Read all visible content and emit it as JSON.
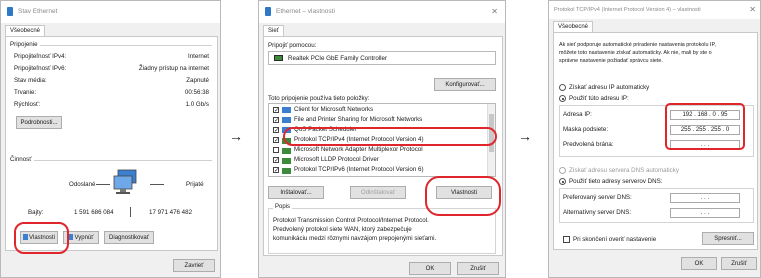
{
  "arrows": [
    "→",
    "→"
  ],
  "win1": {
    "title": "Stav Ethernet",
    "close": "✕",
    "tab": "Všeobecné",
    "connection_group": "Pripojenie",
    "rows": [
      {
        "label": "Pripojiteľnosť IPv4:",
        "value": "Internet"
      },
      {
        "label": "Pripojiteľnosť IPv6:",
        "value": "Žiadny prístup na internet"
      },
      {
        "label": "Stav média:",
        "value": "Zapnuté"
      },
      {
        "label": "Trvanie:",
        "value": "00:56:38"
      },
      {
        "label": "Rýchlosť:",
        "value": "1.0 Gb/s"
      }
    ],
    "details_btn": "Podrobnosti...",
    "activity_group": "Činnosť",
    "sent": "Odoslané",
    "received": "Prijaté",
    "bytes_label": "Bajty:",
    "bytes_sent": "1 591 686 084",
    "bytes_received": "17 971 476 482",
    "properties_btn": "Vlastnosti",
    "disable_btn": "Vypnúť",
    "diagnose_btn": "Diagnostikovať",
    "close_btn": "Zavrieť"
  },
  "win2": {
    "title": "Ethernet – vlastnosti",
    "close": "✕",
    "tab": "Sieť",
    "connect_using": "Pripojiť pomocou:",
    "adapter": "Realtek PCIe GbE Family Controller",
    "configure_btn": "Konfigurovať...",
    "items_label": "Toto pripojenie používa tieto položky:",
    "items": [
      {
        "label": "Client for Microsoft Networks",
        "checked": true
      },
      {
        "label": "File and Printer Sharing for Microsoft Networks",
        "checked": true
      },
      {
        "label": "QoS Packet Scheduler",
        "checked": true
      },
      {
        "label": "Protokol TCP/IPv4 (Internet Protocol Version 4)",
        "checked": true
      },
      {
        "label": "Microsoft Network Adapter Multiplexor Protocol",
        "checked": false
      },
      {
        "label": "Microsoft LLDP Protocol Driver",
        "checked": true
      },
      {
        "label": "Protokol TCP/IPv6 (Internet Protocol Version 6)",
        "checked": true
      }
    ],
    "install_btn": "Inštalovať...",
    "uninstall_btn": "Odinštalovať",
    "properties_btn": "Vlastnosti",
    "description_group": "Popis",
    "description": [
      "Protokol Transmission Control Protocol/Internet Protocol.",
      "Predvolený protokol siete WAN, ktorý zabezpečuje",
      "komunikáciu medzi rôznymi navzájom prepojenými sieťami."
    ],
    "ok_btn": "OK",
    "cancel_btn": "Zrušiť",
    "check_mark": "✓"
  },
  "win3": {
    "title": "Protokol TCP/IPv4 (Internet Protocol Version 4) – vlastnosti",
    "close": "✕",
    "tab": "Všeobecné",
    "intro": [
      "Ak sieť podporuje automatické priradenie nastavenia protokolu IP,",
      "môžete toto nastavenie získať automaticky. Ak nie, mali by ste o",
      "správne nastavenie požiadať správcu siete."
    ],
    "radio_auto_ip": "Získať adresu IP automaticky",
    "radio_manual_ip": "Použiť túto adresu IP:",
    "ip_label": "Adresa IP:",
    "ip_value": "192 . 168 . 0 . 95",
    "mask_label": "Maska podsiete:",
    "mask_value": "255 . 255 . 255 . 0",
    "gateway_label": "Predvolená brána:",
    "gateway_value": ". . .",
    "radio_auto_dns": "Získať adresu servera DNS automaticky",
    "radio_manual_dns": "Použiť tieto adresy serverov DNS:",
    "dns_pref_label": "Preferovaný server DNS:",
    "dns_pref_value": ". . .",
    "dns_alt_label": "Alternatívny server DNS:",
    "dns_alt_value": ". . .",
    "validate_label": "Pri skončení overiť nastavenie",
    "advanced_btn": "Spresniť...",
    "ok_btn": "OK",
    "cancel_btn": "Zrušiť"
  }
}
